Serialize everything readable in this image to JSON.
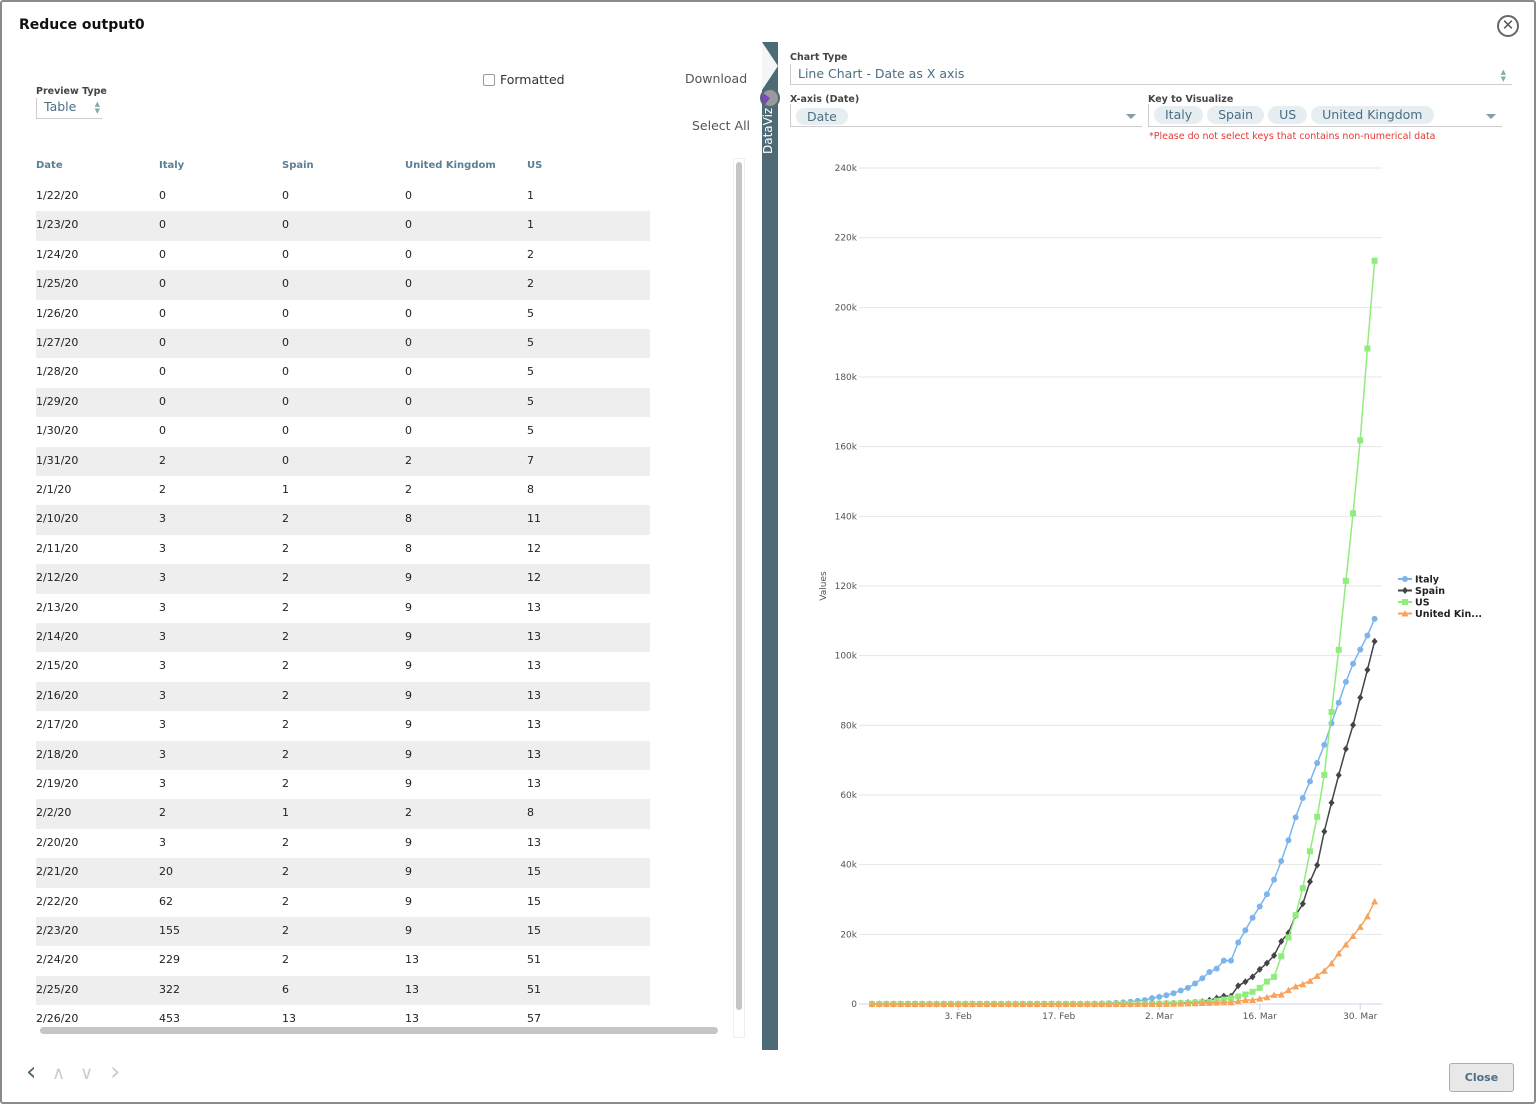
{
  "window": {
    "title": "Reduce output0",
    "close_icon": "circle-x-icon"
  },
  "left_panel": {
    "preview_type_label": "Preview Type",
    "preview_type_value": "Table",
    "formatted_label": "Formatted",
    "formatted_checked": false,
    "download_label": "Download",
    "select_all_label": "Select All"
  },
  "table": {
    "columns": [
      "Date",
      "Italy",
      "Spain",
      "United Kingdom",
      "US"
    ],
    "rows": [
      [
        "1/22/20",
        "0",
        "0",
        "0",
        "1"
      ],
      [
        "1/23/20",
        "0",
        "0",
        "0",
        "1"
      ],
      [
        "1/24/20",
        "0",
        "0",
        "0",
        "2"
      ],
      [
        "1/25/20",
        "0",
        "0",
        "0",
        "2"
      ],
      [
        "1/26/20",
        "0",
        "0",
        "0",
        "5"
      ],
      [
        "1/27/20",
        "0",
        "0",
        "0",
        "5"
      ],
      [
        "1/28/20",
        "0",
        "0",
        "0",
        "5"
      ],
      [
        "1/29/20",
        "0",
        "0",
        "0",
        "5"
      ],
      [
        "1/30/20",
        "0",
        "0",
        "0",
        "5"
      ],
      [
        "1/31/20",
        "2",
        "0",
        "2",
        "7"
      ],
      [
        "2/1/20",
        "2",
        "1",
        "2",
        "8"
      ],
      [
        "2/10/20",
        "3",
        "2",
        "8",
        "11"
      ],
      [
        "2/11/20",
        "3",
        "2",
        "8",
        "12"
      ],
      [
        "2/12/20",
        "3",
        "2",
        "9",
        "12"
      ],
      [
        "2/13/20",
        "3",
        "2",
        "9",
        "13"
      ],
      [
        "2/14/20",
        "3",
        "2",
        "9",
        "13"
      ],
      [
        "2/15/20",
        "3",
        "2",
        "9",
        "13"
      ],
      [
        "2/16/20",
        "3",
        "2",
        "9",
        "13"
      ],
      [
        "2/17/20",
        "3",
        "2",
        "9",
        "13"
      ],
      [
        "2/18/20",
        "3",
        "2",
        "9",
        "13"
      ],
      [
        "2/19/20",
        "3",
        "2",
        "9",
        "13"
      ],
      [
        "2/2/20",
        "2",
        "1",
        "2",
        "8"
      ],
      [
        "2/20/20",
        "3",
        "2",
        "9",
        "13"
      ],
      [
        "2/21/20",
        "20",
        "2",
        "9",
        "15"
      ],
      [
        "2/22/20",
        "62",
        "2",
        "9",
        "15"
      ],
      [
        "2/23/20",
        "155",
        "2",
        "9",
        "15"
      ],
      [
        "2/24/20",
        "229",
        "2",
        "13",
        "51"
      ],
      [
        "2/25/20",
        "322",
        "6",
        "13",
        "51"
      ],
      [
        "2/26/20",
        "453",
        "13",
        "13",
        "57"
      ]
    ]
  },
  "sidebar_tab": {
    "label": "DataViz"
  },
  "config": {
    "chart_type_label": "Chart Type",
    "chart_type_value": "Line Chart - Date as X axis",
    "xaxis_label": "X-axis (Date)",
    "xaxis_value": "Date",
    "key_label": "Key to Visualize",
    "keys": [
      "Italy",
      "Spain",
      "US",
      "United Kingdom"
    ],
    "warning": "*Please do not select keys that contains non-numerical data"
  },
  "chart_data": {
    "type": "line",
    "title": "",
    "xlabel": "",
    "ylabel": "Values",
    "x_start": "2020-01-22",
    "x_end": "2020-04-01",
    "x_ticks": [
      "3. Feb",
      "17. Feb",
      "2. Mar",
      "16. Mar",
      "30. Mar"
    ],
    "y_ticks": [
      "0",
      "20k",
      "40k",
      "60k",
      "80k",
      "100k",
      "120k",
      "140k",
      "160k",
      "180k",
      "200k",
      "220k",
      "240k"
    ],
    "ylim": [
      0,
      240000
    ],
    "grid": true,
    "legend_position": "right",
    "legend_labels": [
      "Italy",
      "Spain",
      "US",
      "United Kin..."
    ],
    "series": [
      {
        "name": "Italy",
        "color": "#7cb5ec",
        "marker": "circle",
        "values": [
          0,
          0,
          0,
          0,
          0,
          0,
          0,
          0,
          0,
          2,
          2,
          2,
          2,
          2,
          2,
          2,
          2,
          2,
          3,
          3,
          3,
          3,
          3,
          3,
          3,
          3,
          3,
          3,
          3,
          3,
          20,
          62,
          155,
          229,
          322,
          453,
          655,
          888,
          1128,
          1694,
          2036,
          2502,
          3089,
          3858,
          4636,
          5883,
          7375,
          9172,
          10149,
          12462,
          12462,
          17660,
          21157,
          24747,
          27980,
          31506,
          35713,
          41035,
          47021,
          53578,
          59138,
          63927,
          69176,
          74386,
          80589,
          86498,
          92472,
          97689,
          101739,
          105792,
          110574
        ]
      },
      {
        "name": "Spain",
        "color": "#434348",
        "marker": "diamond",
        "values": [
          0,
          0,
          0,
          0,
          0,
          0,
          0,
          0,
          0,
          0,
          1,
          1,
          1,
          1,
          1,
          1,
          1,
          1,
          1,
          2,
          2,
          2,
          2,
          2,
          2,
          2,
          2,
          2,
          2,
          2,
          2,
          2,
          2,
          2,
          6,
          13,
          15,
          32,
          45,
          84,
          120,
          165,
          222,
          259,
          400,
          500,
          673,
          1073,
          1695,
          2277,
          2277,
          5232,
          6391,
          7798,
          9942,
          11748,
          13910,
          17963,
          20410,
          25374,
          28768,
          35136,
          39885,
          49515,
          57786,
          65719,
          73235,
          80110,
          87956,
          95923,
          104118
        ]
      },
      {
        "name": "US",
        "color": "#90ed7d",
        "marker": "square",
        "values": [
          1,
          1,
          2,
          2,
          5,
          5,
          5,
          5,
          5,
          7,
          8,
          8,
          11,
          11,
          11,
          11,
          11,
          11,
          11,
          11,
          12,
          12,
          13,
          13,
          13,
          13,
          13,
          13,
          13,
          13,
          15,
          15,
          15,
          51,
          51,
          57,
          58,
          60,
          68,
          74,
          98,
          118,
          149,
          217,
          262,
          402,
          518,
          583,
          959,
          1281,
          1663,
          2179,
          2727,
          3499,
          4632,
          6421,
          7786,
          13680,
          19101,
          25493,
          33276,
          43847,
          53740,
          65778,
          83836,
          101657,
          121478,
          140886,
          161807,
          188172,
          213372
        ]
      },
      {
        "name": "United Kingdom",
        "color": "#f7a35c",
        "marker": "triangle",
        "values": [
          0,
          0,
          0,
          0,
          0,
          0,
          0,
          0,
          0,
          2,
          2,
          2,
          2,
          2,
          2,
          2,
          2,
          2,
          3,
          3,
          8,
          8,
          9,
          9,
          9,
          9,
          9,
          9,
          9,
          9,
          9,
          9,
          9,
          13,
          13,
          13,
          15,
          20,
          23,
          36,
          40,
          51,
          85,
          115,
          163,
          206,
          273,
          321,
          382,
          456,
          456,
          798,
          1140,
          1140,
          1543,
          1950,
          2626,
          2689,
          3983,
          5018,
          5683,
          6650,
          8077,
          9529,
          11658,
          14543,
          17089,
          19522,
          22141,
          25150,
          29474
        ]
      }
    ]
  },
  "footer": {
    "nav_prev_icon": "chevron-left-icon",
    "nav_up_icon": "chevron-up-icon",
    "nav_down_icon": "chevron-down-icon",
    "nav_next_icon": "chevron-right-icon",
    "close_label": "Close"
  }
}
